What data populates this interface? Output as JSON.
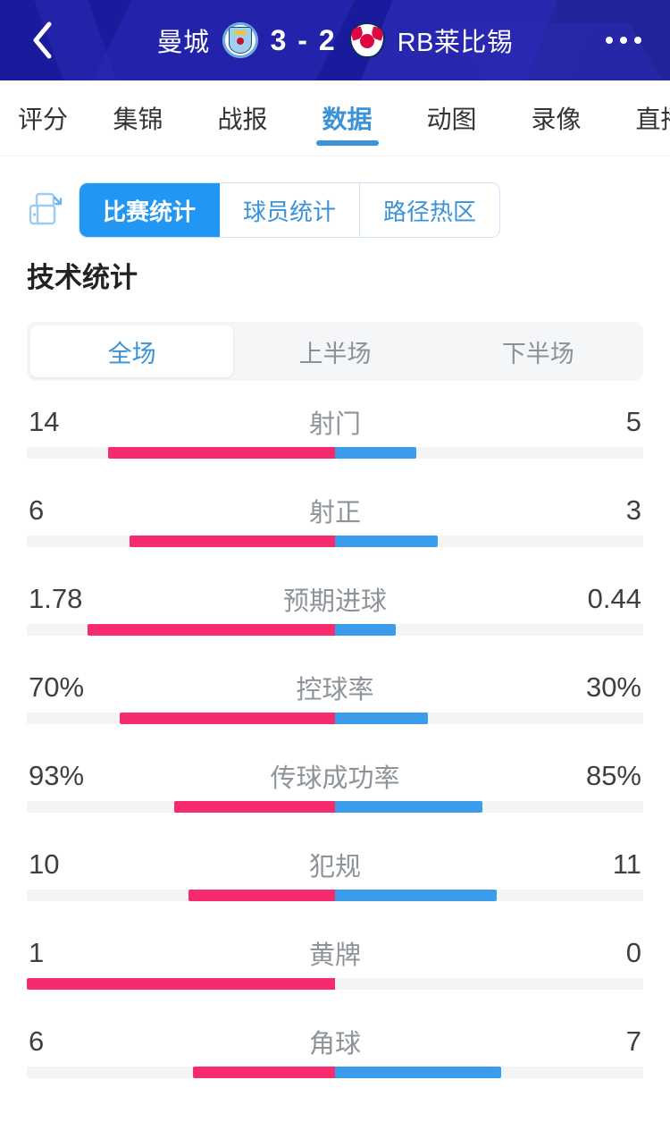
{
  "header": {
    "back_icon": "chevron-left-icon",
    "more_icon": "more-horizontal-icon",
    "home_team": "曼城",
    "away_team": "RB莱比锡",
    "home_crest": "manchester-city-crest",
    "away_crest": "rb-leipzig-crest",
    "score": "3 - 2",
    "home_score": "3",
    "away_score": "2",
    "bg_color": "#1a1a9c"
  },
  "top_tabs": [
    {
      "label": "评分",
      "active": false
    },
    {
      "label": "集锦",
      "active": false
    },
    {
      "label": "战报",
      "active": false
    },
    {
      "label": "数据",
      "active": true
    },
    {
      "label": "动图",
      "active": false
    },
    {
      "label": "录像",
      "active": false
    },
    {
      "label": "直播",
      "active": false
    }
  ],
  "pill_tabs": {
    "icon": "compare-view-icon",
    "items": [
      {
        "label": "比赛统计",
        "active": true
      },
      {
        "label": "球员统计",
        "active": false
      },
      {
        "label": "路径热区",
        "active": false
      }
    ]
  },
  "section": {
    "title": "技术统计"
  },
  "period_segments": [
    {
      "label": "全场",
      "active": true
    },
    {
      "label": "上半场",
      "active": false
    },
    {
      "label": "下半场",
      "active": false
    }
  ],
  "colors": {
    "home_bar": "#f62b6e",
    "away_bar": "#3a9ceb",
    "track": "#f4f4f5",
    "accent": "#3a92d9",
    "pill_active": "#2196f3"
  },
  "chart_data": {
    "type": "bar",
    "title": "技术统计",
    "orientation": "horizontal-diverging",
    "series": [
      {
        "name": "曼城",
        "color": "#f62b6e",
        "side": "left"
      },
      {
        "name": "RB莱比锡",
        "color": "#3a9ceb",
        "side": "right"
      }
    ],
    "categories": [
      "射门",
      "射正",
      "预期进球",
      "控球率",
      "传球成功率",
      "犯规",
      "黄牌",
      "角球"
    ],
    "rows": [
      {
        "label": "射门",
        "home": "14",
        "away": "5",
        "home_num": 14,
        "away_num": 5,
        "home_pct": 73.7,
        "away_pct": 26.3
      },
      {
        "label": "射正",
        "home": "6",
        "away": "3",
        "home_num": 6,
        "away_num": 3,
        "home_pct": 66.7,
        "away_pct": 33.3
      },
      {
        "label": "预期进球",
        "home": "1.78",
        "away": "0.44",
        "home_num": 1.78,
        "away_num": 0.44,
        "home_pct": 80.2,
        "away_pct": 19.8
      },
      {
        "label": "控球率",
        "home": "70%",
        "away": "30%",
        "home_num": 70,
        "away_num": 30,
        "home_pct": 70.0,
        "away_pct": 30.0
      },
      {
        "label": "传球成功率",
        "home": "93%",
        "away": "85%",
        "home_num": 93,
        "away_num": 85,
        "home_pct": 52.2,
        "away_pct": 47.8
      },
      {
        "label": "犯规",
        "home": "10",
        "away": "11",
        "home_num": 10,
        "away_num": 11,
        "home_pct": 47.6,
        "away_pct": 52.4
      },
      {
        "label": "黄牌",
        "home": "1",
        "away": "0",
        "home_num": 1,
        "away_num": 0,
        "home_pct": 100.0,
        "away_pct": 0.0
      },
      {
        "label": "角球",
        "home": "6",
        "away": "7",
        "home_num": 6,
        "away_num": 7,
        "home_pct": 46.2,
        "away_pct": 53.8
      }
    ]
  }
}
